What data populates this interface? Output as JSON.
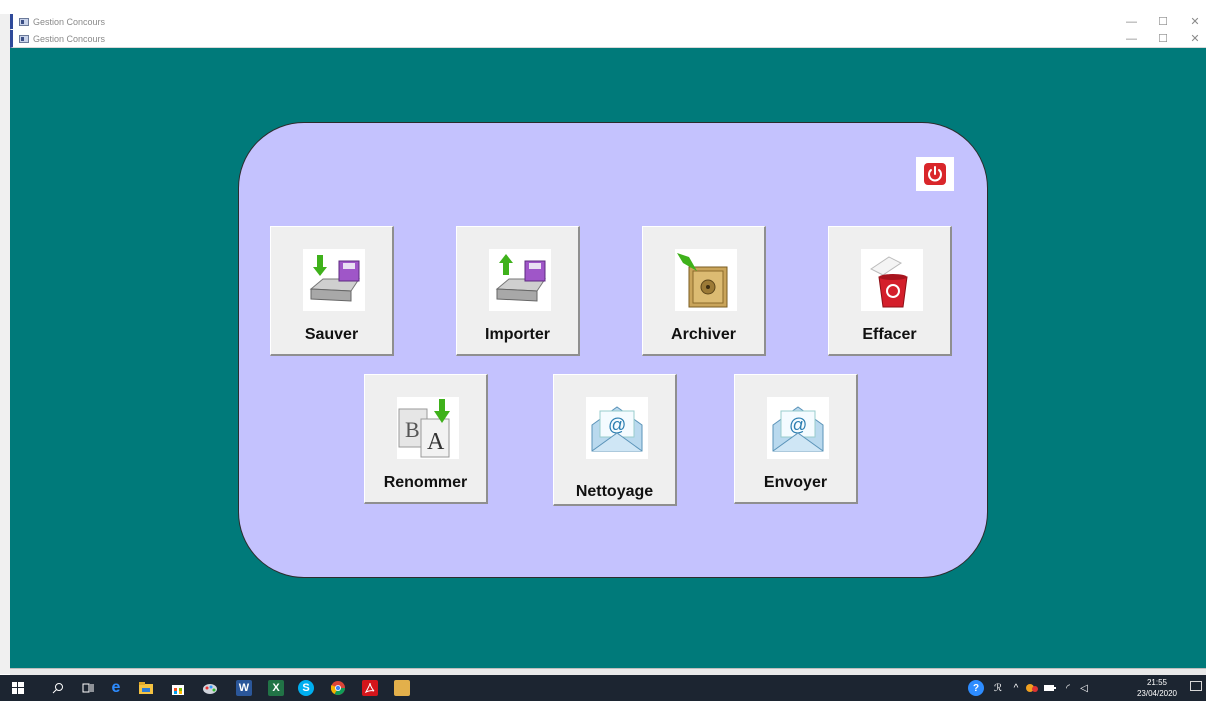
{
  "window": {
    "back_title": "Gestion Concours",
    "front_title": "Gestion Concours",
    "controls": {
      "minimize": "—",
      "maximize": "☐",
      "close": "✕"
    }
  },
  "panel": {
    "accent_background": "#c4c2fe",
    "page_background": "#007a7a",
    "power_button": {
      "icon": "power-icon",
      "color": "#d9262a"
    },
    "buttons": [
      {
        "id": "sauver",
        "label": "Sauver",
        "icon": "save-download-icon"
      },
      {
        "id": "importer",
        "label": "Importer",
        "icon": "import-upload-icon"
      },
      {
        "id": "archiver",
        "label": "Archiver",
        "icon": "archive-safe-icon"
      },
      {
        "id": "effacer",
        "label": "Effacer",
        "icon": "trash-icon"
      },
      {
        "id": "renommer",
        "label": "Renommer",
        "icon": "rename-icon"
      },
      {
        "id": "nettoyage",
        "label": "Nettoyage",
        "icon": "email-icon"
      },
      {
        "id": "envoyer",
        "label": "Envoyer",
        "icon": "email-icon"
      }
    ]
  },
  "taskbar": {
    "time": "21:55",
    "date": "23/04/2020",
    "pinned": [
      "start-icon",
      "search-icon",
      "task-view-icon",
      "edge-icon",
      "file-explorer-icon",
      "store-icon",
      "paint-icon",
      "word-icon",
      "excel-icon",
      "skype-icon",
      "chrome-icon",
      "acrobat-icon",
      "app-icon"
    ],
    "word_label": "W",
    "excel_label": "X",
    "skype_label": "S"
  }
}
